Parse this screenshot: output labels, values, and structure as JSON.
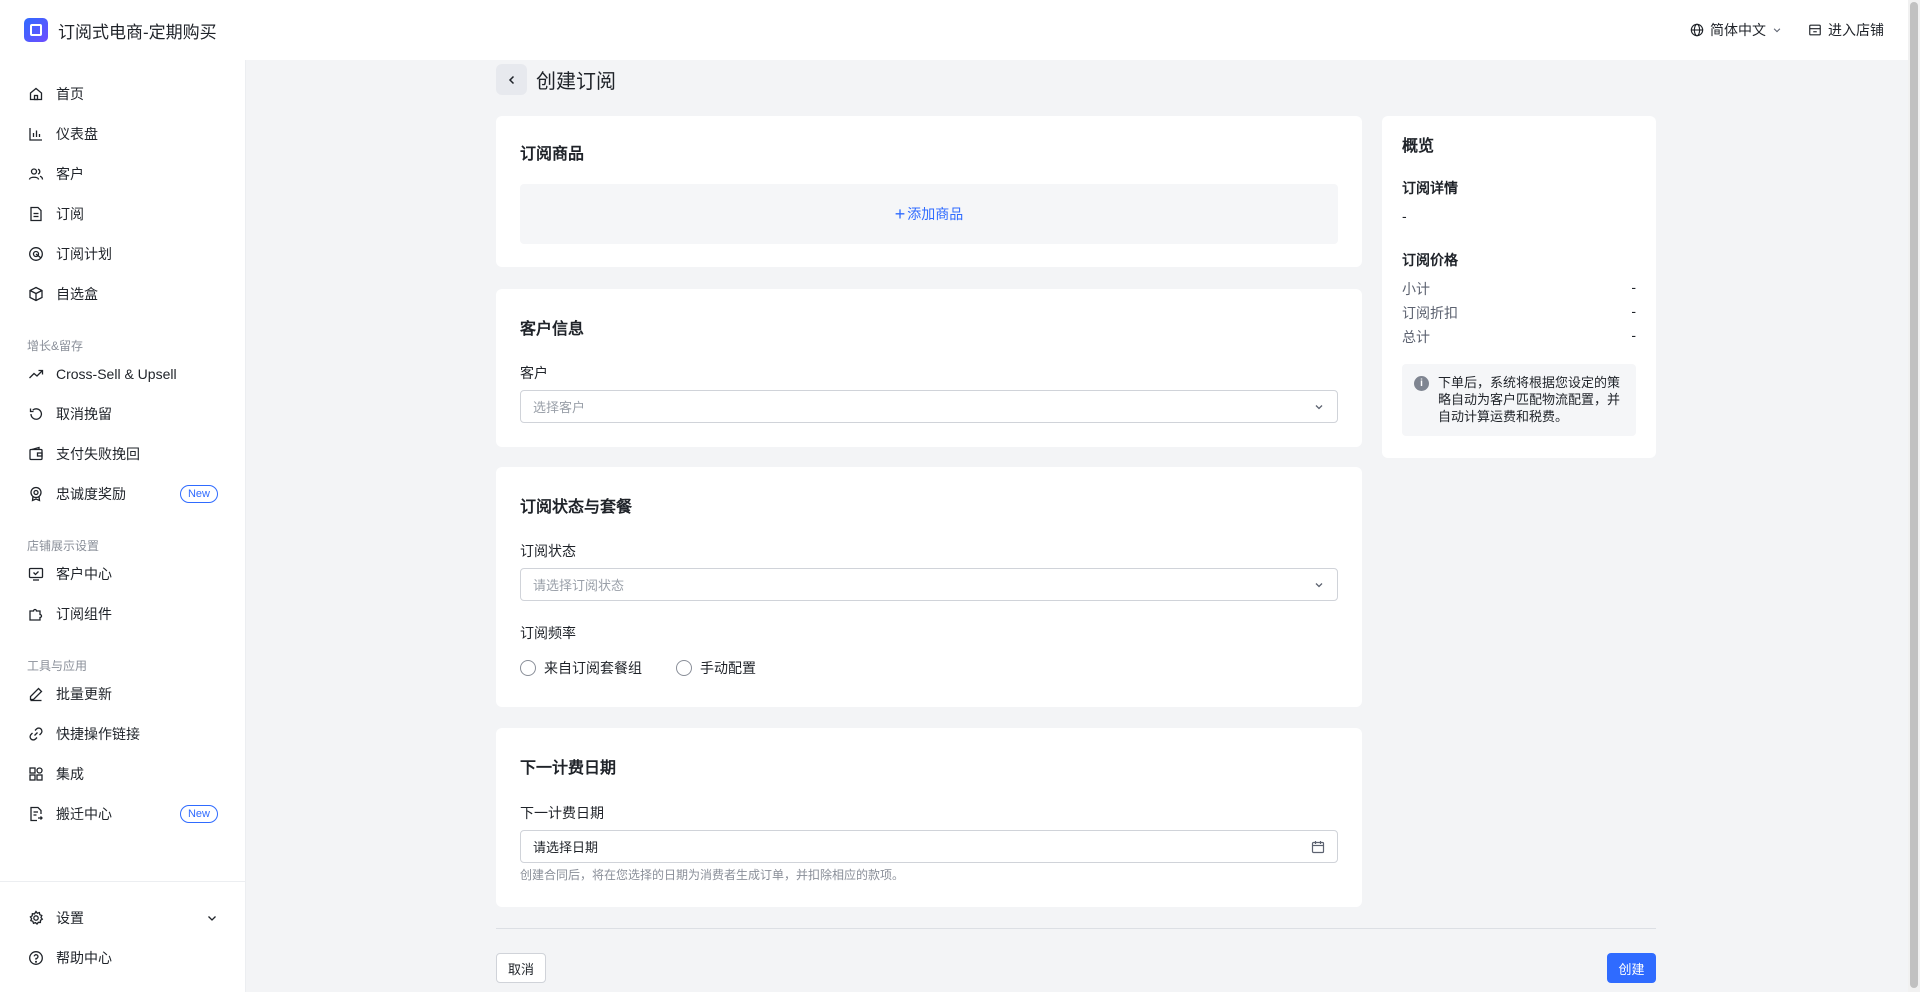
{
  "app": {
    "title": "订阅式电商-定期购买"
  },
  "header": {
    "language": "简体中文",
    "enter_store": "进入店铺"
  },
  "sidebar": {
    "items": [
      {
        "label": "首页",
        "icon": "home-icon"
      },
      {
        "label": "仪表盘",
        "icon": "bar-chart-icon"
      },
      {
        "label": "客户",
        "icon": "users-icon"
      },
      {
        "label": "订阅",
        "icon": "document-icon"
      },
      {
        "label": "订阅计划",
        "icon": "plan-icon"
      },
      {
        "label": "自选盒",
        "icon": "box-icon"
      }
    ],
    "groups": [
      {
        "title": "增长&留存",
        "items": [
          {
            "label": "Cross-Sell & Upsell",
            "icon": "trend-up-icon"
          },
          {
            "label": "取消挽留",
            "icon": "undo-icon"
          },
          {
            "label": "支付失败挽回",
            "icon": "wallet-icon"
          },
          {
            "label": "忠诚度奖励",
            "icon": "award-icon",
            "badge": "New"
          }
        ]
      },
      {
        "title": "店铺展示设置",
        "items": [
          {
            "label": "客户中心",
            "icon": "screen-icon"
          },
          {
            "label": "订阅组件",
            "icon": "puzzle-icon"
          }
        ]
      },
      {
        "title": "工具与应用",
        "items": [
          {
            "label": "批量更新",
            "icon": "pen-icon"
          },
          {
            "label": "快捷操作链接",
            "icon": "link-icon"
          },
          {
            "label": "集成",
            "icon": "apps-icon"
          },
          {
            "label": "搬迁中心",
            "icon": "migrate-icon",
            "badge": "New"
          }
        ]
      }
    ],
    "bottom": [
      {
        "label": "设置",
        "icon": "gear-icon"
      },
      {
        "label": "帮助中心",
        "icon": "help-icon"
      }
    ]
  },
  "page": {
    "title": "创建订阅",
    "products": {
      "title": "订阅商品",
      "add_label": "添加商品"
    },
    "customer": {
      "title": "客户信息",
      "field_label": "客户",
      "placeholder": "选择客户"
    },
    "status": {
      "title": "订阅状态与套餐",
      "status_label": "订阅状态",
      "status_placeholder": "请选择订阅状态",
      "frequency_label": "订阅频率",
      "frequency_options": [
        "来自订阅套餐组",
        "手动配置"
      ]
    },
    "billing": {
      "title": "下一计费日期",
      "field_label": "下一计费日期",
      "placeholder": "请选择日期",
      "hint": "创建合同后，将在您选择的日期为消费者生成订单，并扣除相应的款项。"
    }
  },
  "overview": {
    "title": "概览",
    "details_label": "订阅详情",
    "details_value": "-",
    "price_label": "订阅价格",
    "rows": [
      {
        "label": "小计",
        "value": "-"
      },
      {
        "label": "订阅折扣",
        "value": "-"
      },
      {
        "label": "总计",
        "value": "-"
      }
    ],
    "note": "下单后，系统将根据您设定的策略自动为客户匹配物流配置，并自动计算运费和税费。"
  },
  "footer": {
    "cancel": "取消",
    "create": "创建"
  },
  "colors": {
    "primary": "#2f6bff",
    "background": "#f3f4f6",
    "card": "#ffffff",
    "muted_text": "#8a8f99"
  }
}
